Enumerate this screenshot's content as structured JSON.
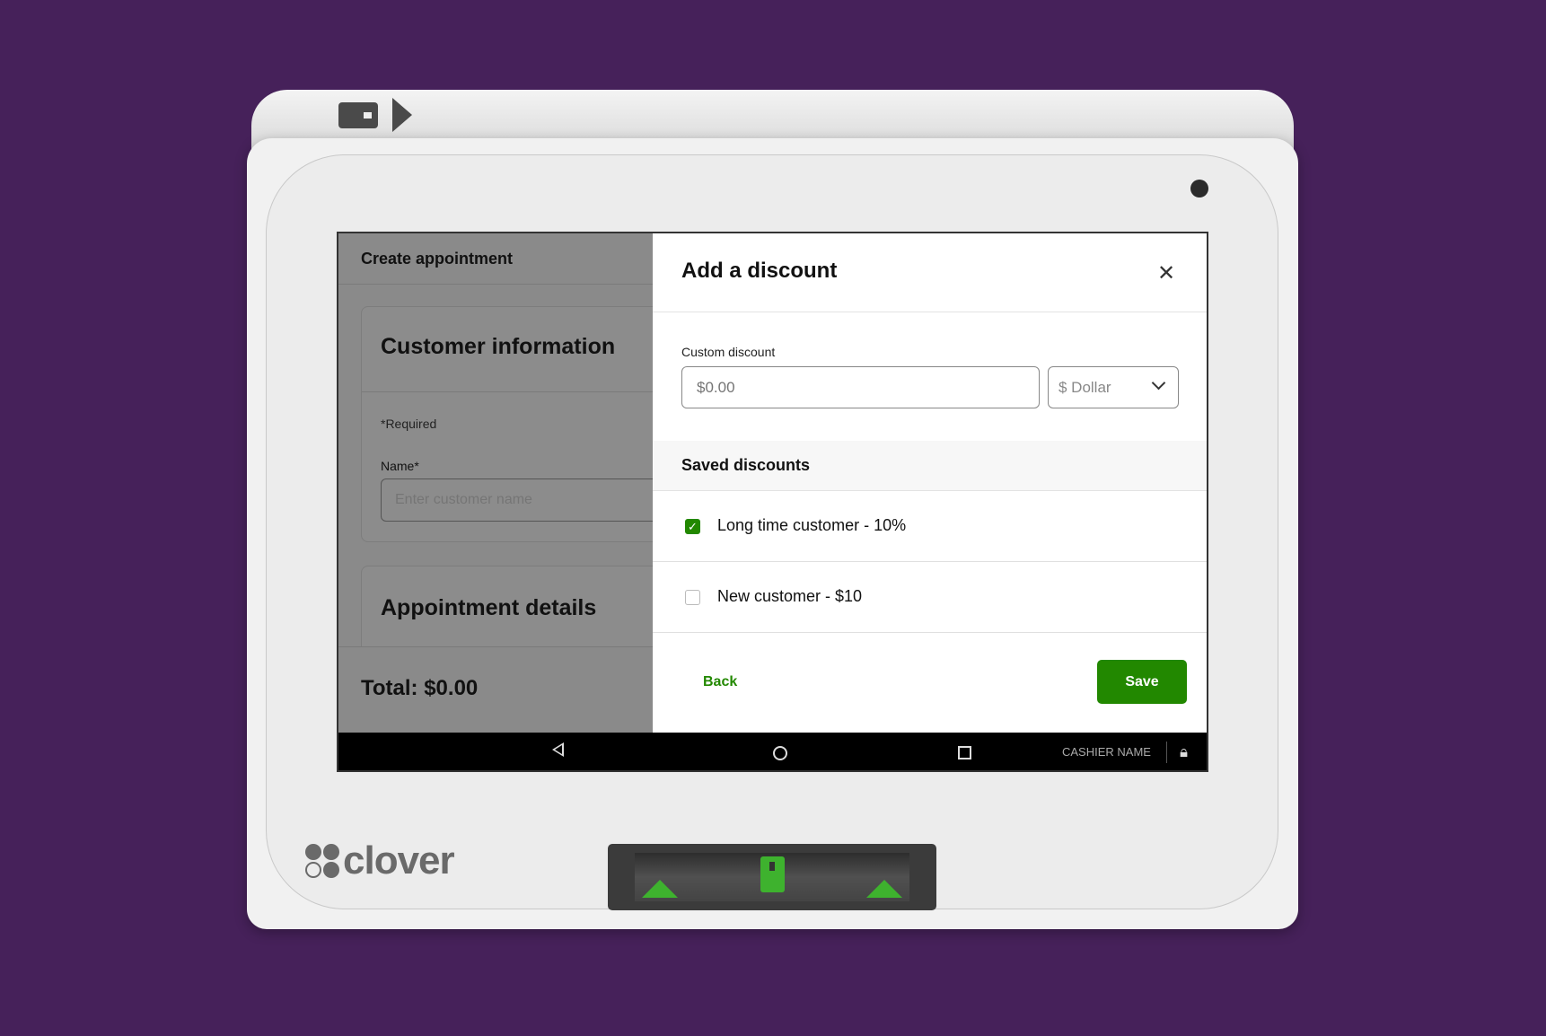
{
  "colors": {
    "background": "#46215a",
    "accent": "#228800",
    "overlay": "#8a8a8a"
  },
  "device": {
    "brand": "clover"
  },
  "background_screen": {
    "header_title": "Create appointment",
    "customer_section": {
      "title": "Customer information",
      "required_note": "*Required",
      "name_label": "Name*",
      "name_placeholder": "Enter customer name"
    },
    "appointment_section": {
      "title": "Appointment details"
    },
    "total": "Total: $0.00"
  },
  "modal": {
    "title": "Add a discount",
    "close_icon": "close-icon",
    "custom_discount": {
      "label": "Custom discount",
      "placeholder": "$0.00",
      "value": "",
      "type_selected": "$ Dollar"
    },
    "saved_discounts": {
      "title": "Saved discounts",
      "items": [
        {
          "label": "Long time customer - 10%",
          "checked": true
        },
        {
          "label": "New customer - $10",
          "checked": false
        }
      ]
    },
    "back_label": "Back",
    "save_label": "Save"
  },
  "navbar": {
    "cashier": "CASHIER NAME",
    "icons": [
      "back-icon",
      "home-icon",
      "recents-icon",
      "lock-icon"
    ]
  }
}
